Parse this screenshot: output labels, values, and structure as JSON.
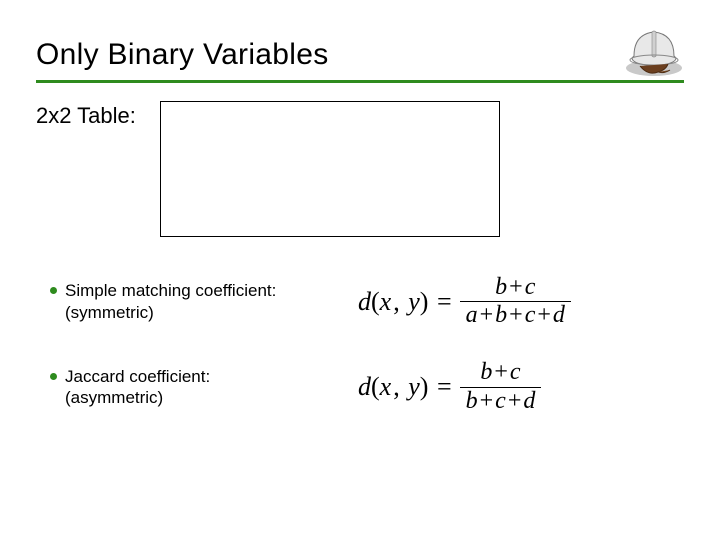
{
  "title": "Only Binary Variables",
  "subheading": "2x2 Table:",
  "bullets": [
    {
      "line1": "Simple matching coefficient:",
      "line2": "(symmetric)"
    },
    {
      "line1": "Jaccard coefficient:",
      "line2": "(asymmetric)"
    }
  ],
  "formulas": [
    {
      "lhs": "d(x, y) =",
      "numerator": "b + c",
      "denominator": "a + b + c + d"
    },
    {
      "lhs": "d(x, y) =",
      "numerator": "b + c",
      "denominator": "b + c + d"
    }
  ]
}
